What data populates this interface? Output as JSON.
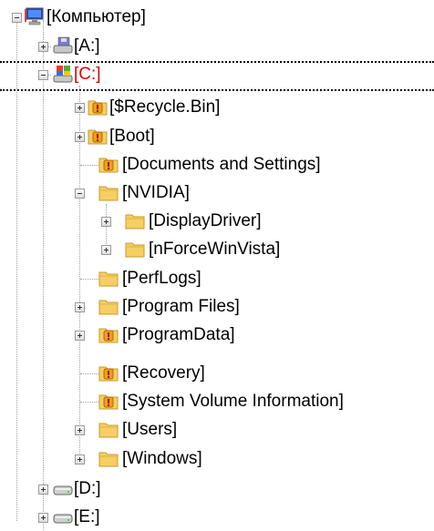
{
  "tree": {
    "root": {
      "label": "[Компьютер]",
      "icon": "computer-icon"
    },
    "drives": [
      {
        "label": "[A:]",
        "icon": "floppy-drive-icon"
      },
      {
        "label": "[C:]",
        "icon": "system-drive-icon",
        "selected": true
      },
      {
        "label": "[D:]",
        "icon": "hard-drive-icon"
      },
      {
        "label": "[E:]",
        "icon": "hard-drive-icon"
      }
    ],
    "c_children": [
      {
        "label": "[$Recycle.Bin]",
        "icon": "restricted-folder-icon"
      },
      {
        "label": "[Boot]",
        "icon": "restricted-folder-icon"
      },
      {
        "label": "[Documents and Settings]",
        "icon": "restricted-folder-icon"
      },
      {
        "label": "[NVIDIA]",
        "icon": "folder-icon"
      },
      {
        "label": "[PerfLogs]",
        "icon": "folder-icon"
      },
      {
        "label": "[Program Files]",
        "icon": "folder-icon"
      },
      {
        "label": "[ProgramData]",
        "icon": "restricted-folder-icon"
      },
      {
        "label": "[Recovery]",
        "icon": "restricted-folder-icon"
      },
      {
        "label": "[System Volume Information]",
        "icon": "restricted-folder-icon"
      },
      {
        "label": "[Users]",
        "icon": "folder-icon"
      },
      {
        "label": "[Windows]",
        "icon": "folder-icon"
      }
    ],
    "nvidia_children": [
      {
        "label": "[DisplayDriver]",
        "icon": "folder-icon"
      },
      {
        "label": "[nForceWinVista]",
        "icon": "folder-icon"
      }
    ]
  },
  "colors": {
    "selected_text": "#e00000",
    "folder": "#f5cf63",
    "restricted_badge": "#e8a020"
  }
}
